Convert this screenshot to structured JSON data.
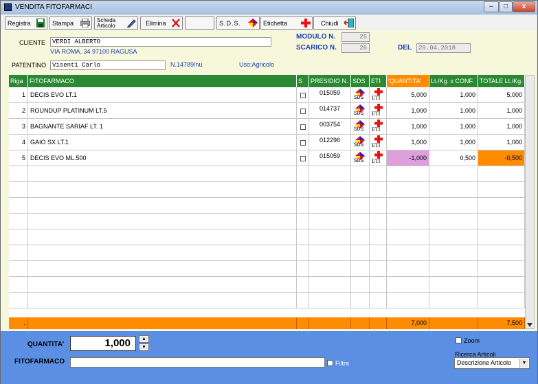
{
  "window": {
    "title": "VENDITA FITOFARMACI",
    "min": "–",
    "max": "□",
    "close": "x"
  },
  "toolbar": {
    "registra": "Registra",
    "stampa": "Stampa",
    "scheda_1": "Scheda",
    "scheda_2": "Articolo",
    "elimina": "Elimina",
    "sds": "S.D.S.",
    "etichetta": "Etichetta",
    "chiudi": "Chiudi"
  },
  "header": {
    "cliente_label": "CLIENTE",
    "cliente_value": "VERDI ALBERTO",
    "cliente_address": "VIA ROMA, 34 97100 RAGUSA",
    "patentino_label": "PATENTINO",
    "patentino_value": "Visenti Carlo",
    "patentino_number": "N.14789/nu",
    "uso": "Uso:Agricolo",
    "modulo_label": "MODULO N.",
    "modulo_value": "25",
    "scarico_label": "SCARICO N.",
    "scarico_value": "26",
    "del_label": "DEL",
    "del_value": "29.04.2018"
  },
  "grid": {
    "columns": [
      "Riga",
      "FITOFARMACO",
      "S",
      "PRESIDIO N.",
      "SDS",
      "ETI",
      "'QUANTITA'",
      "Lt./Kg. x CONF.",
      "TOTALE Lt./Kg."
    ],
    "rows": [
      {
        "riga": "1",
        "fito": "DECIS EVO LT.1",
        "presidio": "015059",
        "sds": "SDS",
        "eti": "ETI",
        "qta": "5,000",
        "conf": "1,000",
        "tot": "5,000"
      },
      {
        "riga": "2",
        "fito": "ROUNDUP PLATINUM LT.5",
        "presidio": "014737",
        "sds": "SDS",
        "eti": "ETI",
        "qta": "1,000",
        "conf": "1,000",
        "tot": "1,000"
      },
      {
        "riga": "3",
        "fito": "BAGNANTE SARIAF LT. 1",
        "presidio": "003754",
        "sds": "SDS",
        "eti": "ETI",
        "qta": "1,000",
        "conf": "1,000",
        "tot": "1,000"
      },
      {
        "riga": "4",
        "fito": "GAIO SX LT.1",
        "presidio": "012296",
        "sds": "SDS",
        "eti": "ETI",
        "qta": "1,000",
        "conf": "1,000",
        "tot": "1,000"
      },
      {
        "riga": "5",
        "fito": "DECIS EVO ML.500",
        "presidio": "015059",
        "sds": "SDS",
        "eti": "ETI",
        "qta": "-1,000",
        "conf": "0,500",
        "tot": "-0,500"
      }
    ],
    "totals": {
      "marker": ".",
      "qta": "7,000",
      "tot": "7,500"
    }
  },
  "bottom": {
    "quantita_label": "QUANTITA'",
    "quantita_value": "1,000",
    "fitofarmaco_label": "FITOFARMACO",
    "filtra_label": "Filtra",
    "zoom_label": "Zoom",
    "ricerca_label": "Ricerca Articoli",
    "ricerca_value": "Descrizione Articolo"
  },
  "colors": {
    "accent_green": "#2a8a34",
    "accent_orange": "#ff8c00",
    "negative_qty": "#dda0dd",
    "panel_blue": "#5b8fe3",
    "header_bg": "#f7f7dc"
  }
}
